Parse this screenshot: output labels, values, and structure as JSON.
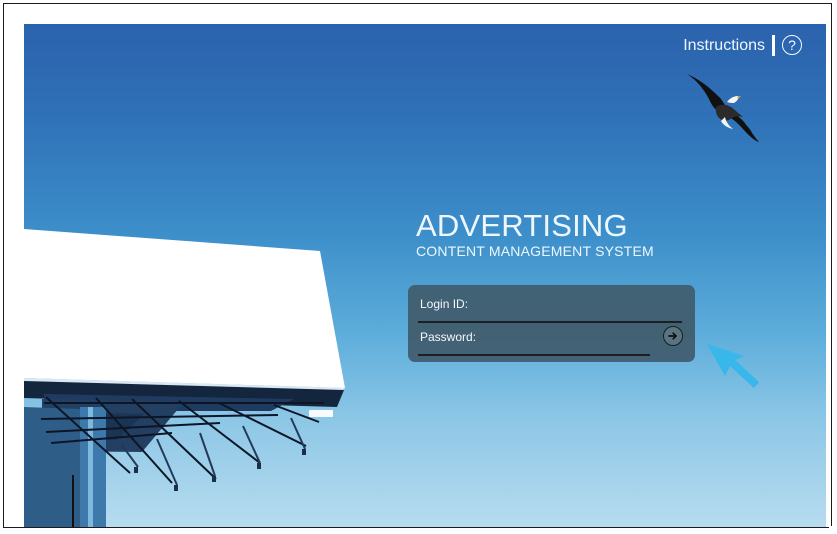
{
  "header": {
    "instructions_label": "Instructions",
    "help_icon_glyph": "?"
  },
  "hero": {
    "title_main": "ADVERTISING",
    "title_sub": "CONTENT MANAGEMENT SYSTEM"
  },
  "login": {
    "login_id_label": "Login ID:",
    "password_label": "Password:"
  },
  "icons": {
    "help": "help-icon",
    "submit": "arrow-right-icon",
    "pointer": "pointer-arrow-icon",
    "eagle": "eagle-icon",
    "billboard": "billboard-icon"
  },
  "colors": {
    "sky_top": "#2b62ad",
    "sky_bottom": "#b7dcef",
    "panel": "#405b6b",
    "accent_arrow": "#38b7ea",
    "text_light": "#eef7ff"
  }
}
